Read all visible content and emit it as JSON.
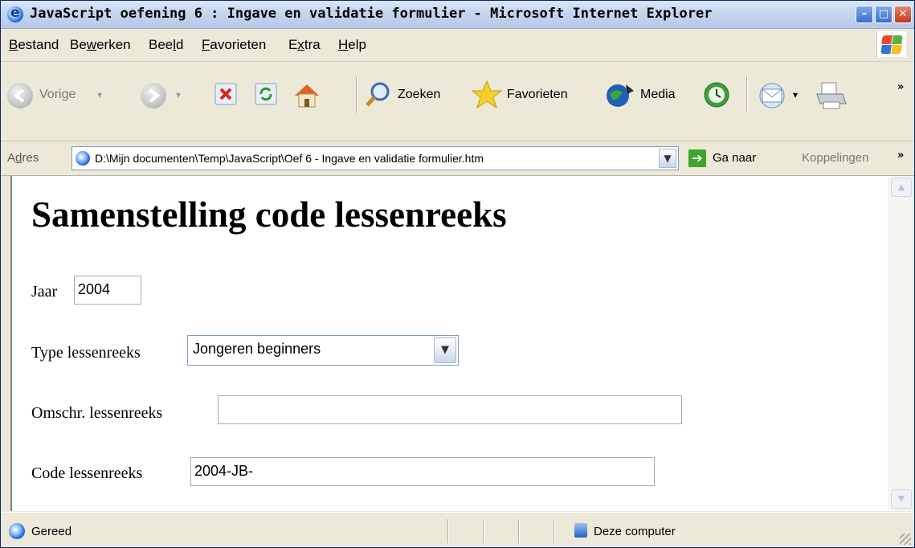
{
  "window": {
    "title": "JavaScript oefening 6 : Ingave en validatie formulier - Microsoft Internet Explorer",
    "min_glyph": "–",
    "max_glyph": "□",
    "close_glyph": "✕"
  },
  "menu": {
    "items": [
      {
        "first": "B",
        "rest": "estand"
      },
      {
        "pre": "Be",
        "u": "w",
        "post": "erken"
      },
      {
        "pre": "Bee",
        "u": "l",
        "post": "d"
      },
      {
        "first": "F",
        "rest": "avorieten"
      },
      {
        "pre": "E",
        "u": "x",
        "post": "tra"
      },
      {
        "first": "H",
        "rest": "elp"
      }
    ]
  },
  "toolbar": {
    "back_label": "Vorige",
    "search_label": "Zoeken",
    "favorites_label": "Favorieten",
    "media_label": "Media",
    "more_glyph": "»",
    "dropdown_glyph": "▾"
  },
  "address": {
    "label_pre": "A",
    "label_u": "d",
    "label_post": "res",
    "url": "D:\\Mijn documenten\\Temp\\JavaScript\\Oef 6 - Ingave en validatie formulier.htm",
    "go_label": "Ga naar",
    "links_label": "Koppelingen",
    "links_more": "»",
    "drop_glyph": "▼",
    "go_glyph": "➔"
  },
  "page": {
    "heading": "Samenstelling code lessenreeks",
    "year_label": "Jaar",
    "year_value": "2004",
    "type_label": "Type lessenreeks",
    "type_value": "Jongeren beginners",
    "type_drop_glyph": "▼",
    "descr_label": "Omschr. lessenreeks",
    "descr_value": "",
    "code_label": "Code lessenreeks",
    "code_value": "2004-JB-"
  },
  "scrollbar": {
    "up_glyph": "▲",
    "down_glyph": "▼"
  },
  "status": {
    "text": "Gereed",
    "zone": "Deze computer"
  }
}
